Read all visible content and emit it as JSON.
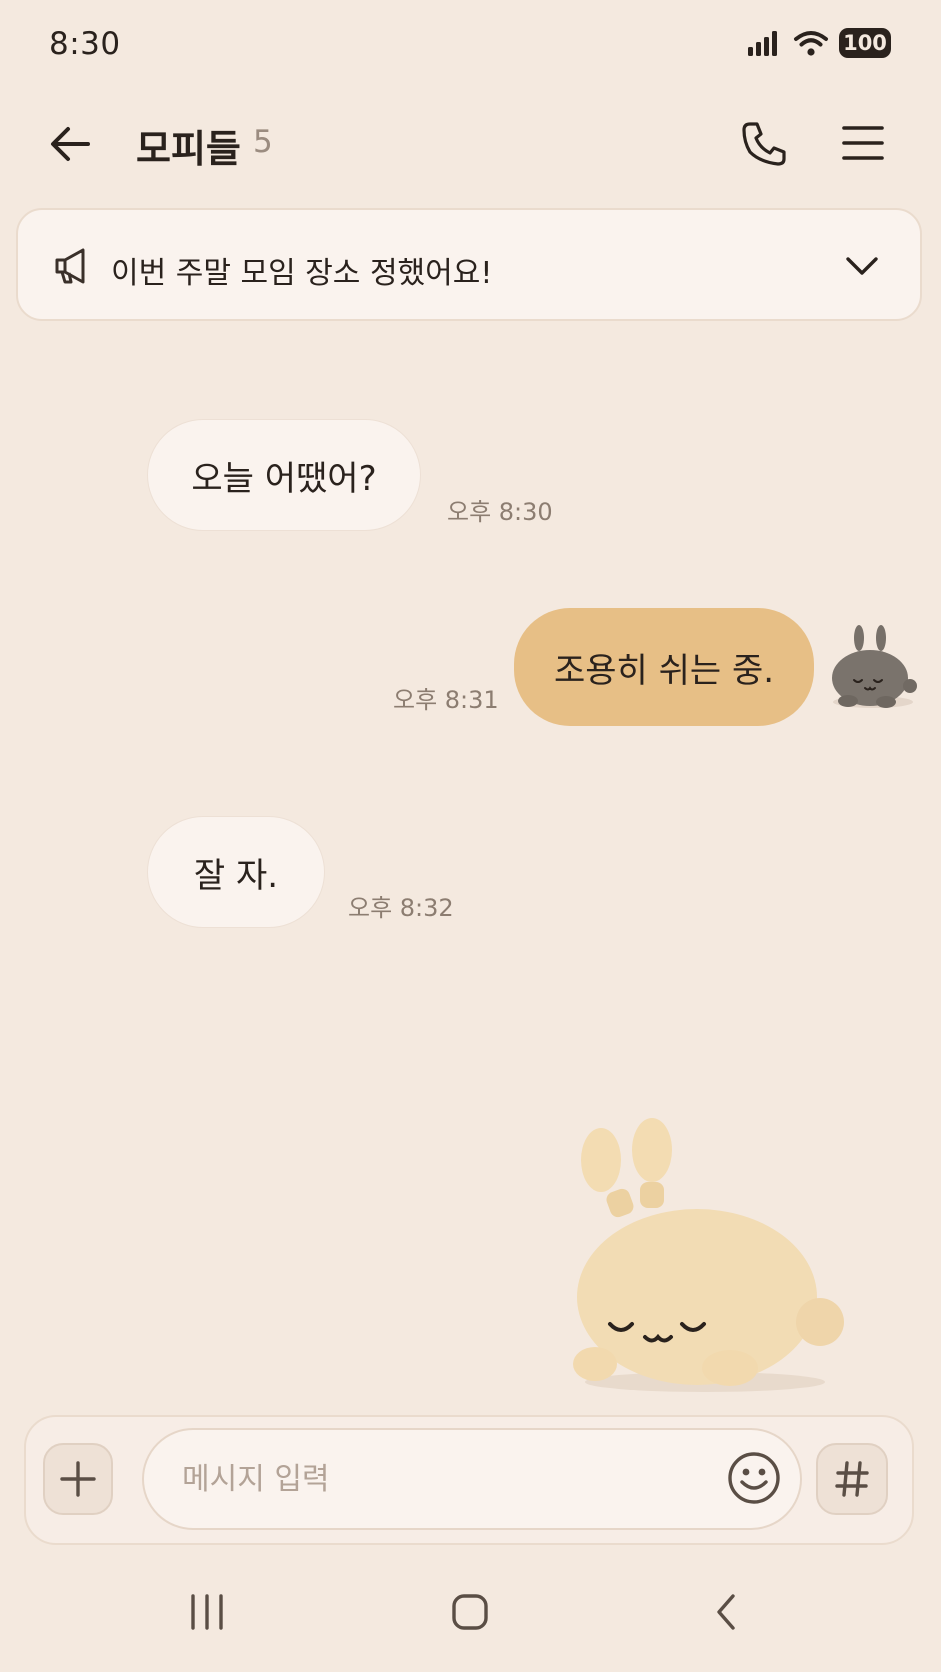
{
  "status_bar": {
    "time": "8:30",
    "battery": "100"
  },
  "header": {
    "title": "모피들",
    "member_count": "5"
  },
  "notice": {
    "text": "이번 주말 모임 장소 정했어요!"
  },
  "messages": [
    {
      "direction": "incoming",
      "text": "오늘 어땠어?",
      "time": "오후 8:30"
    },
    {
      "direction": "outgoing",
      "text": "조용히 쉬는 중.",
      "time": "오후 8:31"
    },
    {
      "direction": "incoming",
      "text": "잘 자.",
      "time": "오후 8:32"
    }
  ],
  "composer": {
    "placeholder": "메시지 입력"
  },
  "colors": {
    "background": "#f4e9df",
    "outgoing_bubble": "#e7bf86",
    "incoming_bubble": "#faf3ee",
    "text": "#2a221d",
    "muted": "#8c7d71"
  },
  "icons": [
    "back-arrow-icon",
    "phone-icon",
    "menu-icon",
    "megaphone-icon",
    "chevron-down-icon",
    "plus-icon",
    "emoji-icon",
    "hash-icon",
    "recent-apps-icon",
    "home-icon",
    "nav-back-icon"
  ]
}
